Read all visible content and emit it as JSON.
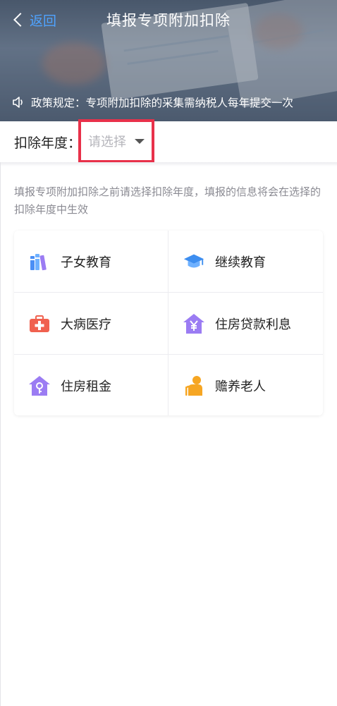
{
  "header": {
    "back_label": "返回",
    "title": "填报专项附加扣除",
    "notice": "政策规定：专项附加扣除的采集需纳税人每年提交一次"
  },
  "year": {
    "label": "扣除年度：",
    "placeholder": "请选择"
  },
  "hint": "填报专项附加扣除之前请选择扣除年度，填报的信息将会在选择的扣除年度中生效",
  "items": [
    {
      "label": "子女教育",
      "icon": "books-icon"
    },
    {
      "label": "继续教育",
      "icon": "graduation-cap-icon"
    },
    {
      "label": "大病医疗",
      "icon": "medical-kit-icon"
    },
    {
      "label": "住房贷款利息",
      "icon": "house-yuan-icon"
    },
    {
      "label": "住房租金",
      "icon": "house-key-icon"
    },
    {
      "label": "赡养老人",
      "icon": "elder-person-icon"
    }
  ],
  "colors": {
    "accent_blue": "#4fa3ff",
    "highlight_red": "#e8314a",
    "icon_purple": "#9b7cf3",
    "icon_red": "#f0614f",
    "icon_orange": "#f6a623"
  }
}
